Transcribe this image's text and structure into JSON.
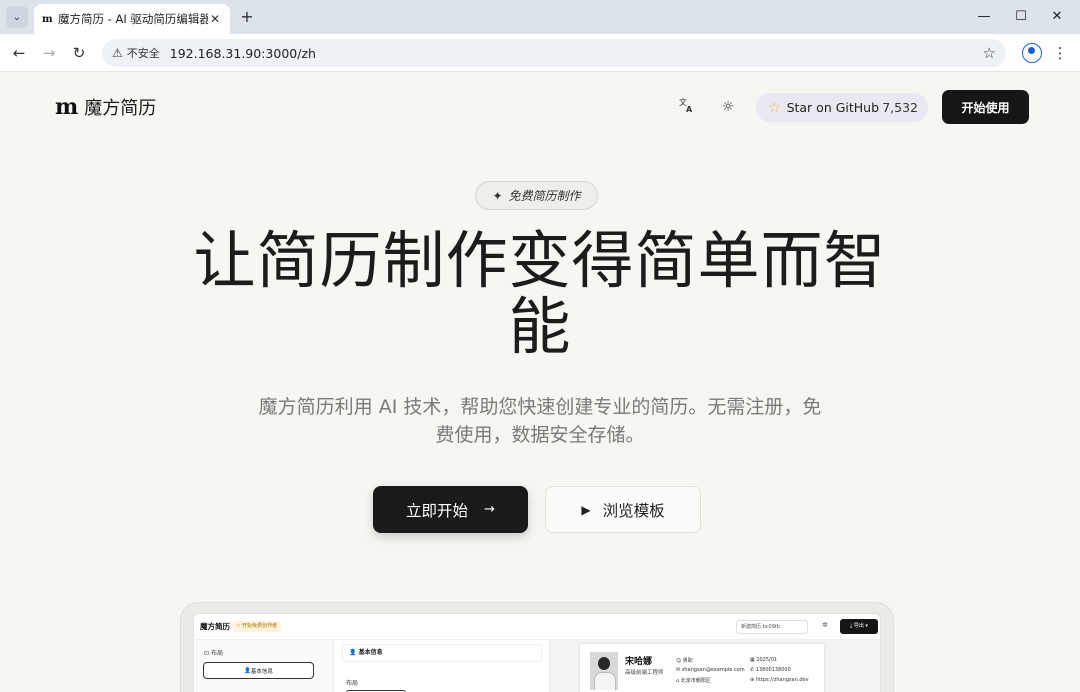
{
  "browser": {
    "tab_title": "魔方简历 - AI 驱动简历编辑器",
    "tab_favicon": "m",
    "security_label": "不安全",
    "url": "192.168.31.90:3000/zh",
    "icons": {
      "tab_menu": "chevron-down-icon",
      "tab_close": "close-icon",
      "new_tab": "plus-icon",
      "back": "arrow-left-icon",
      "forward": "arrow-right-icon",
      "reload": "reload-icon",
      "warning": "warning-icon",
      "bookmark": "star-icon",
      "profile": "profile-icon",
      "menu": "kebab-icon",
      "minimize": "minimize-icon",
      "maximize": "maximize-icon",
      "close": "close-icon"
    }
  },
  "header": {
    "logo_text": "魔方简历",
    "github_label": "Star on GitHub",
    "github_count": "7,532",
    "start_label": "开始使用",
    "icons": {
      "translate": "translate-icon",
      "theme": "sun-icon",
      "github_star": "star-icon"
    }
  },
  "hero": {
    "badge": "免费简历制作",
    "title": "让简历制作变得简单而智能",
    "subtitle": "魔方简历利用 AI 技术，帮助您快速创建专业的简历。无需注册，免费使用，数据安全存储。",
    "primary_cta": "立即开始",
    "secondary_cta": "浏览模板"
  },
  "preview": {
    "logo": "魔方简历",
    "badge": "☆ 开始免费创作者",
    "resume_name_input": "新建简历 bc09fb",
    "export_label": "⤓ 导出 ▾",
    "layout_label": "布局",
    "basic_info_btn": "基本信息",
    "section_title": "基本信息",
    "layout_label2": "布局",
    "resume": {
      "name": "宋哈娜",
      "title": "高级前端工程师",
      "info": [
        "☺ 男职",
        "✉ zhangsan@example.com",
        "⌂ 北京市朝阳区",
        "▦ 2025/01",
        "✆ 13800138000",
        "⊕ https://zhangsan.dev"
      ]
    }
  },
  "colors": {
    "page_bg": "#f7f6f3",
    "primary_dark": "#1a1a1a",
    "github_pill": "#ece8f2",
    "star_yellow": "#e8b44c",
    "muted_text": "#7a7a7a"
  }
}
